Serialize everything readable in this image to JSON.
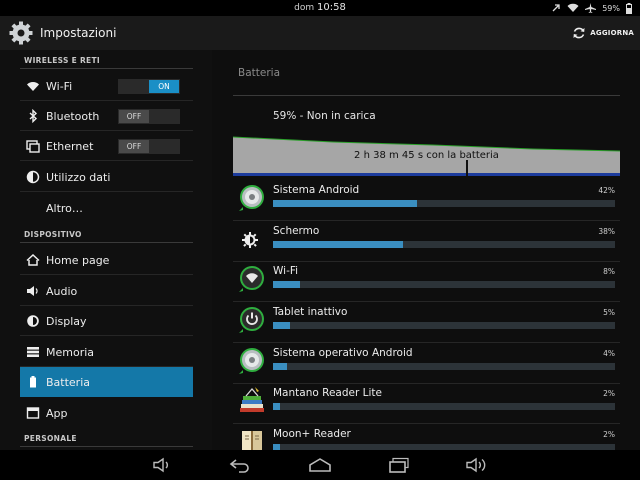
{
  "status": {
    "day": "dom",
    "time": "10:58",
    "battery_pct": "59%"
  },
  "header": {
    "title": "Impostazioni",
    "refresh_label": "AGGIORNA"
  },
  "sidebar": {
    "sections": [
      {
        "title": "WIRELESS E RETI"
      },
      {
        "title": "DISPOSITIVO"
      },
      {
        "title": "PERSONALE"
      }
    ],
    "items": [
      {
        "label": "Wi-Fi",
        "icon": "wifi-icon",
        "toggle": "ON"
      },
      {
        "label": "Bluetooth",
        "icon": "bluetooth-icon",
        "toggle": "OFF"
      },
      {
        "label": "Ethernet",
        "icon": "ethernet-icon",
        "toggle": "OFF"
      },
      {
        "label": "Utilizzo dati",
        "icon": "data-usage-icon"
      },
      {
        "label": "Altro…"
      },
      {
        "label": "Home page",
        "icon": "home-icon"
      },
      {
        "label": "Audio",
        "icon": "speaker-icon"
      },
      {
        "label": "Display",
        "icon": "display-brightness-icon"
      },
      {
        "label": "Memoria",
        "icon": "storage-icon"
      },
      {
        "label": "Batteria",
        "icon": "battery-icon",
        "selected": true
      },
      {
        "label": "App",
        "icon": "apps-icon"
      }
    ]
  },
  "main": {
    "title": "Batteria",
    "charge_status": "59% - Non in carica",
    "graph_label": "2 h 38 m 45 s con la batteria",
    "usages": [
      {
        "name": "Sistema Android",
        "percent": "42%",
        "fraction": 0.42,
        "icon": "android-system-icon"
      },
      {
        "name": "Schermo",
        "percent": "38%",
        "fraction": 0.38,
        "icon": "screen-brightness-icon"
      },
      {
        "name": "Wi-Fi",
        "percent": "8%",
        "fraction": 0.08,
        "icon": "wifi-usage-icon"
      },
      {
        "name": "Tablet inattivo",
        "percent": "5%",
        "fraction": 0.05,
        "icon": "power-icon"
      },
      {
        "name": "Sistema operativo Android",
        "percent": "4%",
        "fraction": 0.04,
        "icon": "android-os-icon"
      },
      {
        "name": "Mantano Reader Lite",
        "percent": "2%",
        "fraction": 0.02,
        "icon": "mantano-reader-icon"
      },
      {
        "name": "Moon+ Reader",
        "percent": "2%",
        "fraction": 0.02,
        "icon": "moon-reader-icon"
      }
    ]
  },
  "navbar": {
    "buttons": [
      "volume-down-icon",
      "back-icon",
      "home-nav-icon",
      "recent-apps-icon",
      "volume-up-icon"
    ]
  }
}
